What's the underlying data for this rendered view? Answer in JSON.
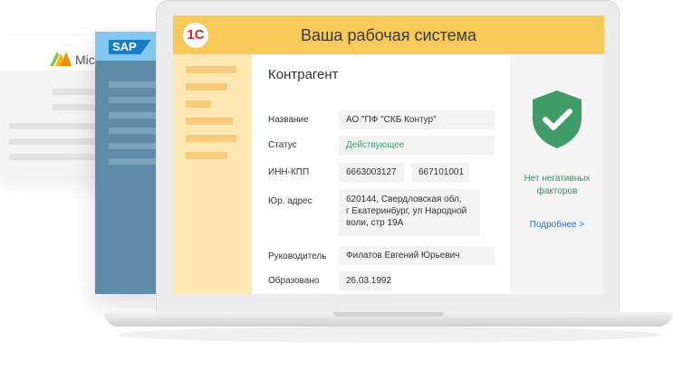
{
  "background_windows": {
    "microsoft": {
      "label": "Mic"
    },
    "sap": {
      "label": "SAP"
    }
  },
  "app": {
    "logo": "1С",
    "title": "Ваша рабочая система"
  },
  "card": {
    "title": "Контрагент",
    "fields": [
      {
        "label": "Название",
        "values": [
          "АО \"ПФ \"СКБ Контур\""
        ]
      },
      {
        "label": "Статус",
        "values": [
          "Действующее"
        ]
      },
      {
        "label": "ИНН-КПП",
        "values": [
          "6663003127",
          "667101001"
        ]
      },
      {
        "label": "Юр. адрес",
        "lines": [
          "620144, Свердловская обл,",
          "г Екатеринбург, ул Народной",
          "воли, стр 19А"
        ]
      },
      {
        "label": "Руководитель",
        "values": [
          "Филатов Евгений Юрьевич"
        ]
      },
      {
        "label": "Образовано",
        "values": [
          "26.03.1992"
        ]
      }
    ]
  },
  "status_panel": {
    "icon": "shield-check-icon",
    "text_line1": "Нет негативных",
    "text_line2": "факторов",
    "link": "Подробнее >"
  },
  "colors": {
    "header": "#f7c85a",
    "sidebar": "#fde7b2",
    "status_green": "#3ea06e",
    "shield_green": "#3f9b68",
    "link_blue": "#2b72b8",
    "sap_panel": "#5e8ca8"
  }
}
